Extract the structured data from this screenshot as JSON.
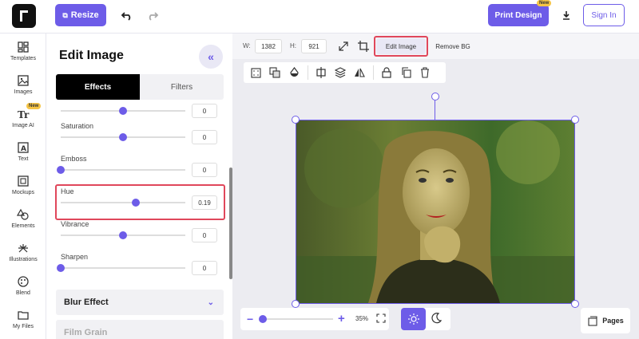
{
  "topbar": {
    "resize_label": "Resize",
    "print_label": "Print Design",
    "print_badge": "New",
    "signin_label": "Sign In"
  },
  "nav": {
    "templates": "Templates",
    "images": "Images",
    "image_ai": "Image AI",
    "image_ai_badge": "New",
    "text": "Text",
    "mockups": "Mockups",
    "elements": "Elements",
    "illustrations": "Illustrations",
    "blend": "Blend",
    "my_files": "My Files"
  },
  "panel": {
    "title": "Edit Image",
    "tabs": [
      "Effects",
      "Filters"
    ],
    "sliders": [
      {
        "label": "",
        "value": "0",
        "position": 0.5
      },
      {
        "label": "Saturation",
        "value": "0",
        "position": 0.5
      },
      {
        "label": "Emboss",
        "value": "0",
        "position": 0.0
      },
      {
        "label": "Hue",
        "value": "0.19",
        "position": 0.6
      },
      {
        "label": "Vibrance",
        "value": "0",
        "position": 0.5
      },
      {
        "label": "Sharpen",
        "value": "0",
        "position": 0.0
      }
    ],
    "accordions": [
      "Blur Effect",
      "Film Grain"
    ]
  },
  "toolbar": {
    "w_label": "W:",
    "w_value": "1382",
    "h_label": "H:",
    "h_value": "921",
    "edit_image_label": "Edit Image",
    "remove_bg_label": "Remove BG"
  },
  "zoom": {
    "value": "35%",
    "position": 0.0
  },
  "pages_label": "Pages",
  "colors": {
    "accent": "#6d5ce8",
    "highlight": "#e0475b"
  }
}
